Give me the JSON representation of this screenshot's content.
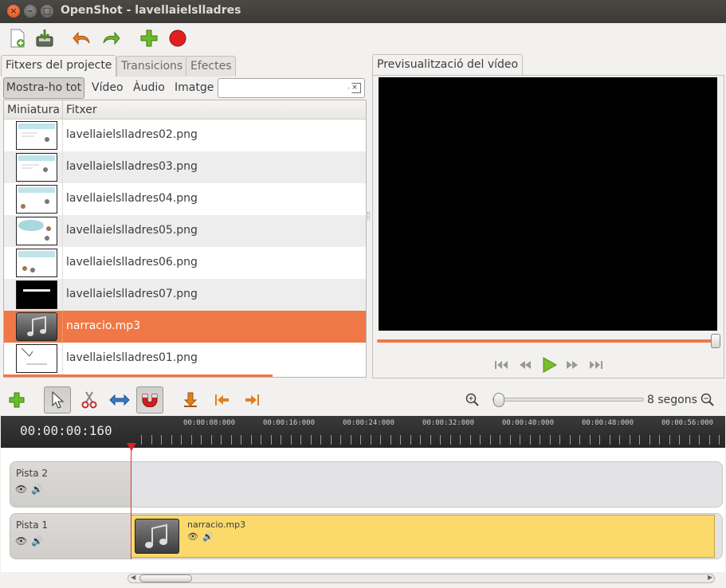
{
  "window": {
    "title": "OpenShot - lavellaielslladres"
  },
  "colors": {
    "accent": "#f07746",
    "clip": "#fcd96b",
    "record": "#e02020"
  },
  "tabs_left": [
    {
      "label": "Fitxers del projecte",
      "active": true
    },
    {
      "label": "Transicions",
      "active": false
    },
    {
      "label": "Efectes",
      "active": false
    }
  ],
  "filters": {
    "all": "Mostra-ho tot",
    "video": "Vídeo",
    "audio": "Àudio",
    "image": "Imatge"
  },
  "search": {
    "value": "",
    "placeholder": ""
  },
  "file_list": {
    "columns": [
      "Miniatura",
      "Fitxer"
    ],
    "rows": [
      {
        "name": "lavellaielslladres02.png",
        "thumb": "slide"
      },
      {
        "name": "lavellaielslladres03.png",
        "thumb": "slide"
      },
      {
        "name": "lavellaielslladres04.png",
        "thumb": "slide"
      },
      {
        "name": "lavellaielslladres05.png",
        "thumb": "slide-blue"
      },
      {
        "name": "lavellaielslladres06.png",
        "thumb": "slide"
      },
      {
        "name": "lavellaielslladres07.png",
        "thumb": "dark"
      },
      {
        "name": "narracio.mp3",
        "thumb": "audio",
        "selected": true
      },
      {
        "name": "lavellaielslladres01.png",
        "thumb": "title"
      }
    ]
  },
  "preview": {
    "tab_label": "Previsualització del vídeo",
    "position": 1.0
  },
  "timeline": {
    "time": "00:00:00:160",
    "zoom_label": "8 segons",
    "zoom_level": 0.03,
    "ticks": [
      "00:00:08:000",
      "00:00:16:000",
      "00:00:24:000",
      "00:00:32:000",
      "00:00:40:000",
      "00:00:48:000",
      "00:00:56:000"
    ],
    "tracks": [
      {
        "name": "Pista 2"
      },
      {
        "name": "Pista 1",
        "clip": "narracio.mp3"
      }
    ]
  }
}
